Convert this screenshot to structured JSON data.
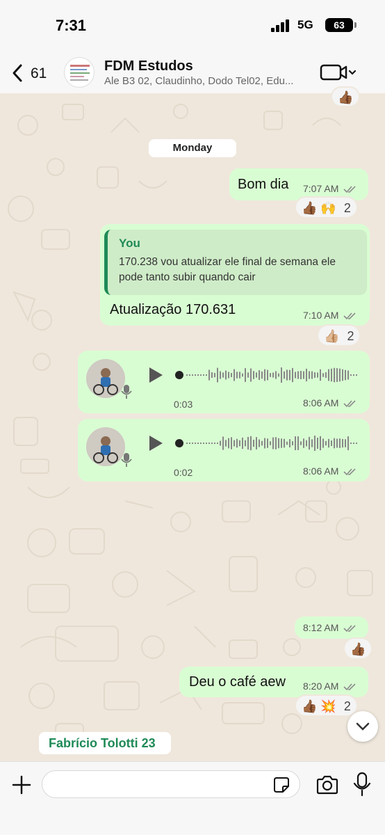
{
  "status_bar": {
    "time": "7:31",
    "network": "5G",
    "battery": "63"
  },
  "header": {
    "back_count": "61",
    "group_name": "FDM Estudos",
    "members": "Ale B3 02, Claudinho, Dodo Tel02, Edu..."
  },
  "chat": {
    "top_reaction": "👍🏾",
    "day_label": "Monday",
    "messages": [
      {
        "text": "Bom dia",
        "time": "7:07 AM",
        "reactions": "👍🏾 🙌",
        "reaction_count": "2"
      },
      {
        "quote_author": "You",
        "quote_text": "170.238 vou atualizar ele final de semana ele pode tanto subir quando cair",
        "text": "Atualização 170.631",
        "time": "7:10 AM",
        "reactions": "👍🏼",
        "reaction_count": "2"
      },
      {
        "type": "voice",
        "duration": "0:03",
        "time": "8:06 AM"
      },
      {
        "type": "voice",
        "duration": "0:02",
        "time": "8:06 AM"
      },
      {
        "text": "",
        "time": "8:12 AM",
        "reactions": "👍🏾",
        "reaction_count": ""
      },
      {
        "text": "Deu o café aew",
        "time": "8:20 AM",
        "reactions": "👍🏾 💥",
        "reaction_count": "2"
      }
    ],
    "sender_chip": "Fabrício Tolotti 23"
  },
  "composer": {
    "placeholder": ""
  },
  "colors": {
    "outgoing_bubble": "#d9fdd3",
    "accent_green": "#1f8a57",
    "tick_gray": "#8a8a8a"
  },
  "icons": [
    "back-chevron-icon",
    "video-call-icon",
    "chevron-down-icon",
    "double-check-icon",
    "play-icon",
    "mic-icon",
    "plus-icon",
    "sticker-icon",
    "camera-icon"
  ]
}
